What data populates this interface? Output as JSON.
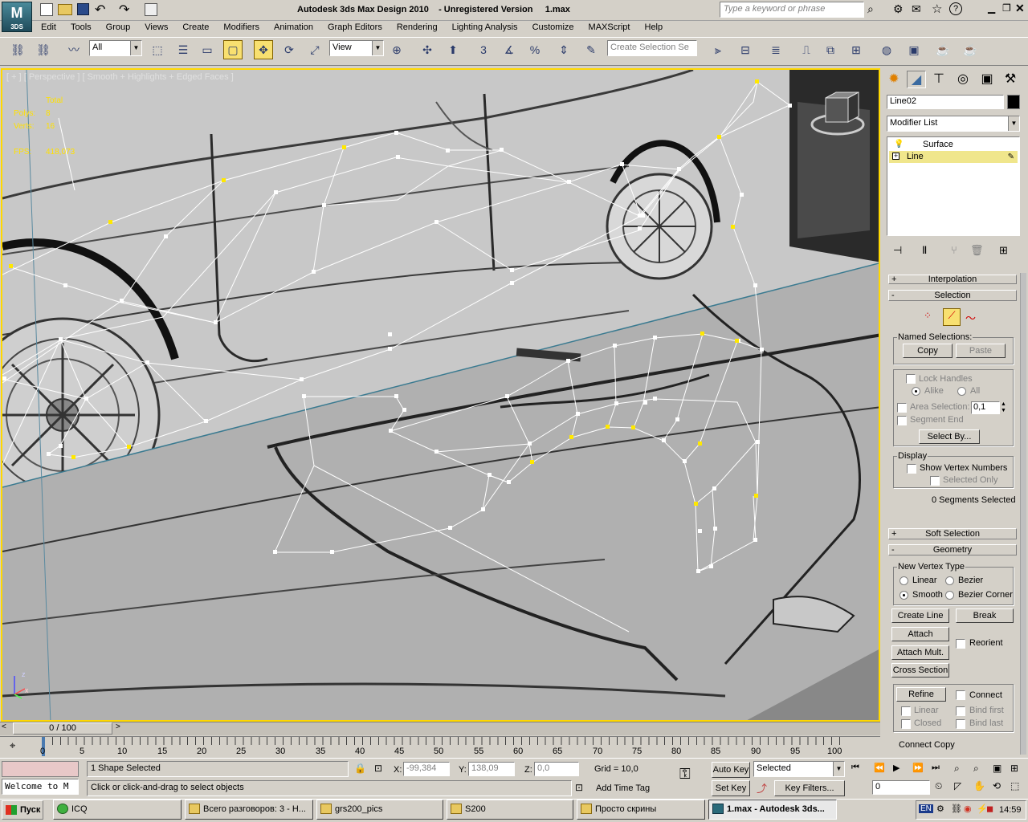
{
  "title_bar": {
    "title": "Autodesk 3ds Max Design 2010    - Unregistered Version     1.max",
    "search_placeholder": "Type a keyword or phrase",
    "logo_text": "3DS"
  },
  "menu": [
    "Edit",
    "Tools",
    "Group",
    "Views",
    "Create",
    "Modifiers",
    "Animation",
    "Graph Editors",
    "Rendering",
    "Lighting Analysis",
    "Customize",
    "MAXScript",
    "Help"
  ],
  "toolbar": {
    "filter_value": "All",
    "coord_value": "View",
    "selection_set_placeholder": "Create Selection Se",
    "snap_3": "3",
    "snap_pct": "%"
  },
  "viewport": {
    "label": "[ + ] [ Perspective ] [ Smooth + Highlights + Edged Faces ]",
    "stats": {
      "total_label": "Total",
      "polys_label": "Polys:",
      "polys_value": "8",
      "verts_label": "Verts:",
      "verts_value": "16",
      "fps_label": "FPS:",
      "fps_value": "418,073"
    },
    "axis_z": "z",
    "axis_x": "x"
  },
  "command_panel": {
    "object_name": "Line02",
    "modifier_list": "Modifier List",
    "stack": [
      {
        "label": "Surface",
        "selected": false
      },
      {
        "label": "Line",
        "selected": true
      }
    ],
    "rollouts": {
      "interpolation": "Interpolation",
      "selection": "Selection",
      "soft_selection": "Soft Selection",
      "geometry": "Geometry"
    },
    "selection": {
      "named_selections": "Named Selections:",
      "copy": "Copy",
      "paste": "Paste",
      "lock_handles": "Lock Handles",
      "alike": "Alike",
      "all": "All",
      "area_selection": "Area Selection:",
      "area_value": "0,1",
      "segment_end": "Segment End",
      "select_by": "Select By...",
      "display": "Display",
      "show_vertex_numbers": "Show Vertex Numbers",
      "selected_only": "Selected Only",
      "status": "0 Segments Selected"
    },
    "geometry": {
      "new_vertex_type": "New Vertex Type",
      "linear": "Linear",
      "bezier": "Bezier",
      "smooth": "Smooth",
      "bezier_corner": "Bezier Corner",
      "create_line": "Create Line",
      "break": "Break",
      "attach": "Attach",
      "reorient": "Reorient",
      "attach_mult": "Attach Mult.",
      "cross_section": "Cross Section",
      "refine": "Refine",
      "connect": "Connect",
      "linear2": "Linear",
      "bind_first": "Bind first",
      "closed": "Closed",
      "bind_last": "Bind last",
      "connect_copy": "Connect Copy"
    }
  },
  "timeline": {
    "frame": "0 / 100",
    "ticks": [
      "0",
      "5",
      "10",
      "15",
      "20",
      "25",
      "30",
      "35",
      "40",
      "45",
      "50",
      "55",
      "60",
      "65",
      "70",
      "75",
      "80",
      "85",
      "90",
      "95",
      "100"
    ]
  },
  "status": {
    "maxscript_text": "Welcome to M",
    "selection_info": "1 Shape Selected",
    "prompt": "Click or click-and-drag to select objects",
    "x_label": "X:",
    "x_value": "-99,384",
    "y_label": "Y:",
    "y_value": "138,09",
    "z_label": "Z:",
    "z_value": "0,0",
    "grid": "Grid = 10,0",
    "add_time_tag": "Add Time Tag",
    "auto_key": "Auto Key",
    "set_key": "Set Key",
    "key_mode": "Selected",
    "key_filters": "Key Filters...",
    "frame_value": "0"
  },
  "taskbar": {
    "start": "Пуск",
    "tasks": [
      {
        "label": "ICQ",
        "active": false
      },
      {
        "label": "Всего разговоров: 3 - Н...",
        "active": false
      },
      {
        "label": "grs200_pics",
        "active": false
      },
      {
        "label": "S200",
        "active": false
      },
      {
        "label": "Просто скрины",
        "active": false
      },
      {
        "label": "1.max - Autodesk 3ds...",
        "active": true
      }
    ],
    "lang": "EN",
    "clock": "14:59"
  }
}
